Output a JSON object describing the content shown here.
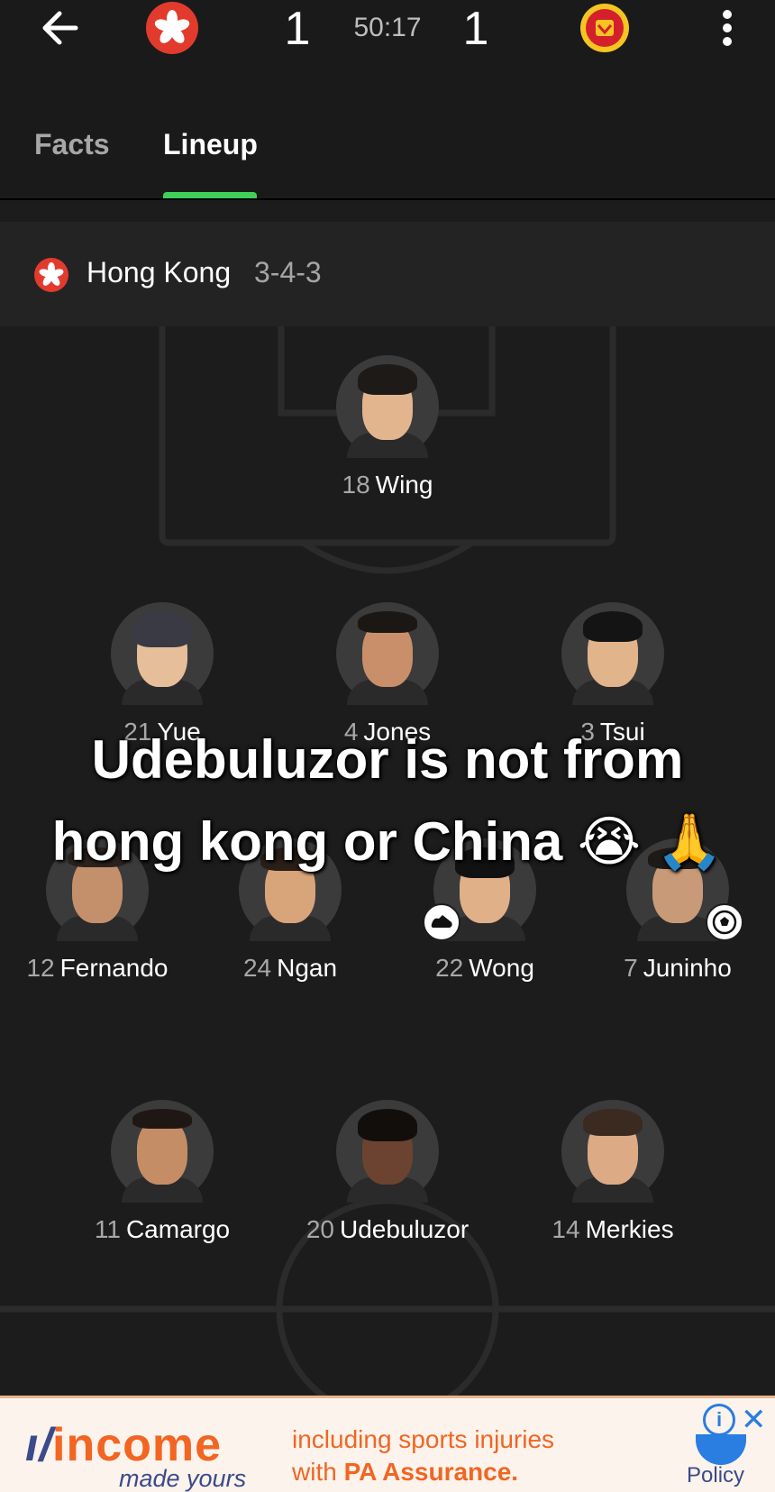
{
  "header": {
    "home_score": "1",
    "away_score": "1",
    "clock": "50:17"
  },
  "tabs": [
    {
      "label": "Facts"
    },
    {
      "label": "Lineup"
    }
  ],
  "team": {
    "name": "Hong Kong",
    "formation": "3-4-3"
  },
  "players": [
    {
      "number": "18",
      "name": "Wing"
    },
    {
      "number": "21",
      "name": "Yue"
    },
    {
      "number": "4",
      "name": "Jones"
    },
    {
      "number": "3",
      "name": "Tsui"
    },
    {
      "number": "12",
      "name": "Fernando"
    },
    {
      "number": "24",
      "name": "Ngan"
    },
    {
      "number": "22",
      "name": "Wong"
    },
    {
      "number": "7",
      "name": "Juninho"
    },
    {
      "number": "11",
      "name": "Camargo"
    },
    {
      "number": "20",
      "name": "Udebuluzor"
    },
    {
      "number": "14",
      "name": "Merkies"
    }
  ],
  "caption": {
    "line1": "Udebuluzor is not from",
    "line2": "hong kong or China 😭 🙏"
  },
  "ad": {
    "brand": "income",
    "tagline": "made yours",
    "line1": "including sports injuries",
    "line2_prefix": "with",
    "line2_bold": "PA Assurance.",
    "policy": "Policy",
    "info": "i",
    "close": "✕"
  },
  "colors": {
    "accent_green": "#3fd05a",
    "hk_red": "#e23b2e",
    "ad_orange": "#f26522"
  }
}
